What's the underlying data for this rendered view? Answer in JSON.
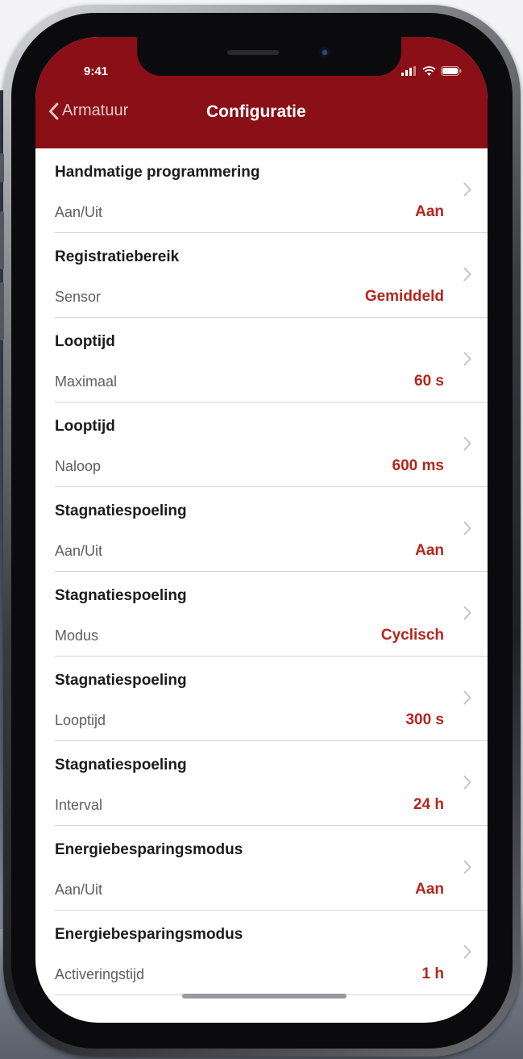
{
  "status_bar": {
    "time": "9:41"
  },
  "nav": {
    "back_label": "Armatuur",
    "title": "Configuratie"
  },
  "settings": [
    {
      "title": "Handmatige programmering",
      "label": "Aan/Uit",
      "value": "Aan"
    },
    {
      "title": "Registratiebereik",
      "label": "Sensor",
      "value": "Gemiddeld"
    },
    {
      "title": "Looptijd",
      "label": "Maximaal",
      "value": "60 s"
    },
    {
      "title": "Looptijd",
      "label": "Naloop",
      "value": "600 ms"
    },
    {
      "title": "Stagnatiespoeling",
      "label": "Aan/Uit",
      "value": "Aan"
    },
    {
      "title": "Stagnatiespoeling",
      "label": "Modus",
      "value": "Cyclisch"
    },
    {
      "title": "Stagnatiespoeling",
      "label": "Looptijd",
      "value": "300 s"
    },
    {
      "title": "Stagnatiespoeling",
      "label": "Interval",
      "value": "24 h"
    },
    {
      "title": "Energiebesparingsmodus",
      "label": "Aan/Uit",
      "value": "Aan"
    },
    {
      "title": "Energiebesparingsmodus",
      "label": "Activeringstijd",
      "value": "1 h"
    }
  ],
  "colors": {
    "header": "#8a0f17",
    "value": "#b3261e"
  }
}
